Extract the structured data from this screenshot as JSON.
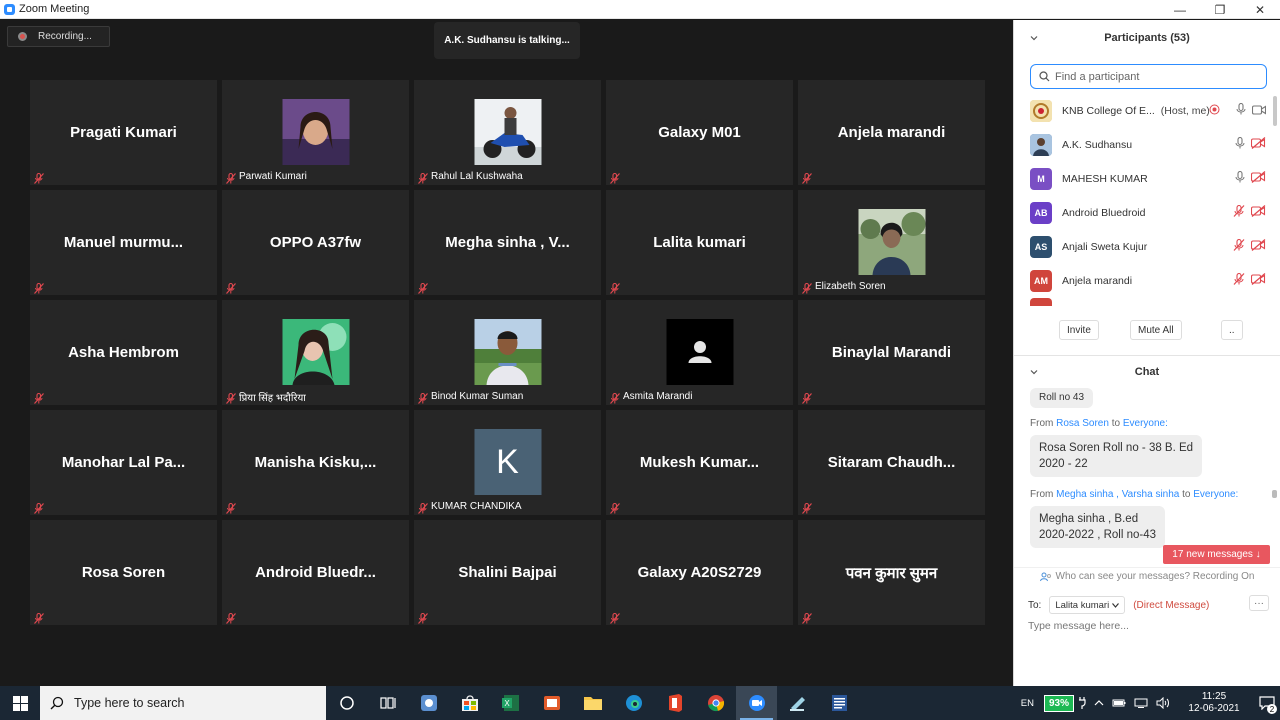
{
  "window": {
    "title": "Zoom Meeting",
    "controls": [
      "—",
      "❐",
      "✕"
    ]
  },
  "meeting": {
    "recording_label": "Recording...",
    "talking_label": "A.K. Sudhansu is talking...",
    "tiles": [
      {
        "name": "Pragati Kumari",
        "label": "",
        "kind": "name"
      },
      {
        "name": "",
        "label": "Parwati Kumari",
        "kind": "photo",
        "photo": "p1"
      },
      {
        "name": "",
        "label": "Rahul Lal Kushwaha",
        "kind": "photo",
        "photo": "p2"
      },
      {
        "name": "Galaxy M01",
        "label": "",
        "kind": "name"
      },
      {
        "name": "Anjela marandi",
        "label": "",
        "kind": "name"
      },
      {
        "name": "Manuel  murmu...",
        "label": "",
        "kind": "name"
      },
      {
        "name": "OPPO A37fw",
        "label": "",
        "kind": "name"
      },
      {
        "name": "Megha sinha , V...",
        "label": "",
        "kind": "name"
      },
      {
        "name": "Lalita kumari",
        "label": "",
        "kind": "name"
      },
      {
        "name": "",
        "label": "Elizabeth Soren",
        "kind": "photo",
        "photo": "p3"
      },
      {
        "name": "Asha Hembrom",
        "label": "",
        "kind": "name"
      },
      {
        "name": "",
        "label": "प्रिया सिंह भदौरिया",
        "kind": "photo",
        "photo": "p4"
      },
      {
        "name": "",
        "label": "Binod Kumar Suman",
        "kind": "photo",
        "photo": "p5"
      },
      {
        "name": "",
        "label": "Asmita Marandi",
        "kind": "photo",
        "photo": "p6"
      },
      {
        "name": "Binaylal Marandi",
        "label": "",
        "kind": "name"
      },
      {
        "name": "Manohar Lal Pa...",
        "label": "",
        "kind": "name"
      },
      {
        "name": "Manisha  Kisku,...",
        "label": "",
        "kind": "name"
      },
      {
        "name": "",
        "label": "KUMAR CHANDIKA",
        "kind": "letter",
        "letter": "K"
      },
      {
        "name": "Mukesh  Kumar...",
        "label": "",
        "kind": "name"
      },
      {
        "name": "Sitaram  Chaudh...",
        "label": "",
        "kind": "name"
      },
      {
        "name": "Rosa Soren",
        "label": "",
        "kind": "name"
      },
      {
        "name": "Android  Bluedr...",
        "label": "",
        "kind": "name"
      },
      {
        "name": "Shalini Bajpai",
        "label": "",
        "kind": "name"
      },
      {
        "name": "Galaxy A20S2729",
        "label": "",
        "kind": "name"
      },
      {
        "name": "पवन कुमार सुमन",
        "label": "",
        "kind": "name"
      }
    ]
  },
  "participants": {
    "header": "Participants (53)",
    "search_placeholder": "Find a participant",
    "list": [
      {
        "name": "KNB College Of E...",
        "tag": "(Host, me)",
        "avatar_text": "",
        "avatar_color": "#e8c77a",
        "mic": "on",
        "video": "on",
        "rec": true
      },
      {
        "name": "A.K. Sudhansu",
        "tag": "",
        "avatar_text": "",
        "avatar_color": "#5b7fa8",
        "mic": "on",
        "video": "off",
        "rec": false
      },
      {
        "name": "MAHESH KUMAR",
        "tag": "",
        "avatar_text": "M",
        "avatar_color": "#7a4fc4",
        "mic": "on",
        "video": "off",
        "rec": false
      },
      {
        "name": "Android Bluedroid",
        "tag": "",
        "avatar_text": "AB",
        "avatar_color": "#6b3fc7",
        "mic": "off",
        "video": "off",
        "rec": false
      },
      {
        "name": "Anjali Sweta Kujur",
        "tag": "",
        "avatar_text": "AS",
        "avatar_color": "#2d4f6e",
        "mic": "off",
        "video": "off",
        "rec": false
      },
      {
        "name": "Anjela marandi",
        "tag": "",
        "avatar_text": "AM",
        "avatar_color": "#d0453c",
        "mic": "off",
        "video": "off",
        "rec": false
      }
    ],
    "invite_label": "Invite",
    "mute_all_label": "Mute All",
    "more_label": ".."
  },
  "chat": {
    "header": "Chat",
    "partial_bubble": "Roll no 43",
    "messages": [
      {
        "from_prefix": "From",
        "sender": "Rosa Soren",
        "to_word": "to",
        "recipient": "Everyone:",
        "text_line1": "Rosa Soren Roll no - 38 B. Ed",
        "text_line2": "2020 - 22"
      },
      {
        "from_prefix": "From",
        "sender": "Megha sinha , Varsha sinha",
        "to_word": "to",
        "recipient": "Everyone:",
        "text_line1": "Megha sinha  , B.ed",
        "text_line2": "2020-2022 , Roll no-43"
      }
    ],
    "new_messages": "17 new messages ↓",
    "who_can_see": "Who can see your messages? Recording On",
    "to_label": "To:",
    "to_value": "Lalita kumari",
    "direct_message": "(Direct Message)",
    "more": "···",
    "input_placeholder": "Type message here..."
  },
  "taskbar": {
    "search_placeholder": "Type here to search",
    "lang": "EN",
    "battery": "93%",
    "time": "11:25",
    "date": "12-06-2021",
    "notification_count": "2"
  }
}
